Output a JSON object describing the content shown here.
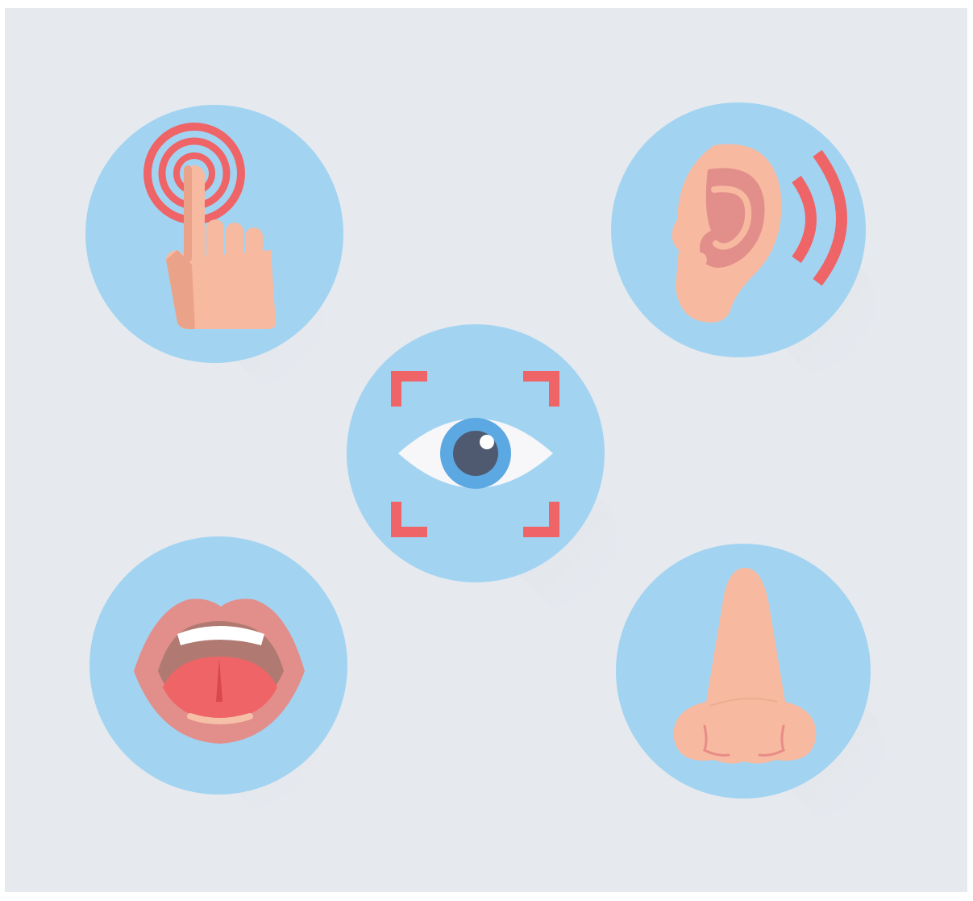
{
  "illustration": {
    "icons": [
      {
        "name": "touch-icon"
      },
      {
        "name": "hearing-icon"
      },
      {
        "name": "sight-icon"
      },
      {
        "name": "taste-icon"
      },
      {
        "name": "smell-icon"
      }
    ]
  },
  "colors": {
    "background": "#e6e9ee",
    "circle": "#a2d4f2",
    "shadow": "#cfd3d9",
    "skin": "#f7b9a0",
    "skin_shade": "#eaa389",
    "accent_red": "#ef6467",
    "iris": "#5ba8e2",
    "pupil": "#4f5a70"
  }
}
